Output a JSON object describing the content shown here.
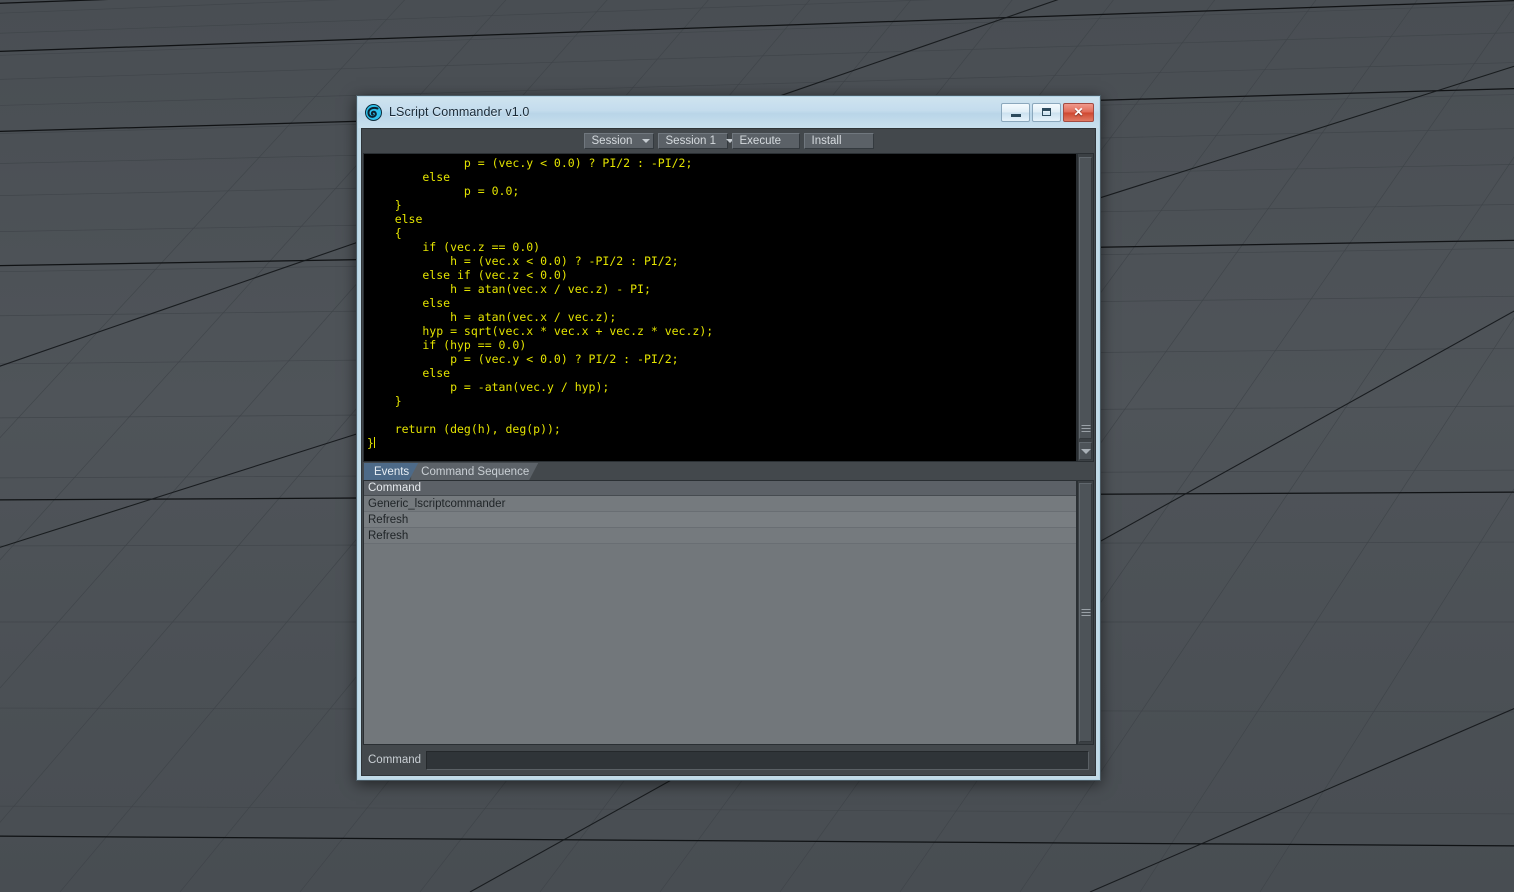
{
  "window": {
    "title": "LScript Commander v1.0",
    "icon": "lightwave-swirl-icon",
    "minimize_label": "–",
    "maximize_label": "□",
    "close_label": "✕"
  },
  "toolbar": {
    "session_dropdown": "Session",
    "session_select": "Session 1",
    "execute_label": "Execute",
    "install_label": "Install"
  },
  "editor": {
    "code": "              p = (vec.y < 0.0) ? PI/2 : -PI/2;\n        else\n              p = 0.0;\n    }\n    else\n    {\n        if (vec.z == 0.0)\n            h = (vec.x < 0.0) ? -PI/2 : PI/2;\n        else if (vec.z < 0.0)\n            h = atan(vec.x / vec.z) - PI;\n        else\n            h = atan(vec.x / vec.z);\n        hyp = sqrt(vec.x * vec.x + vec.z * vec.z);\n        if (hyp == 0.0)\n            p = (vec.y < 0.0) ? PI/2 : -PI/2;\n        else\n            p = -atan(vec.y / hyp);\n    }\n\n    return (deg(h), deg(p));\n}",
    "text_color": "#e3e300",
    "background_color": "#000000"
  },
  "tabs": [
    {
      "label": "Events",
      "active": true
    },
    {
      "label": "Command Sequence",
      "active": false
    }
  ],
  "list": {
    "columns": [
      "Command"
    ],
    "rows": [
      {
        "command": "Generic_lscriptcommander"
      },
      {
        "command": "Refresh"
      },
      {
        "command": "Refresh"
      }
    ]
  },
  "command_bar": {
    "label": "Command",
    "value": "",
    "placeholder": ""
  },
  "colors": {
    "window_frame": "#c2dbe8",
    "panel": "#43484c",
    "tab_active": "#4d6a88",
    "list_background": "#797e82",
    "viewport": "#4c5156",
    "close_button": "#cf4730"
  }
}
